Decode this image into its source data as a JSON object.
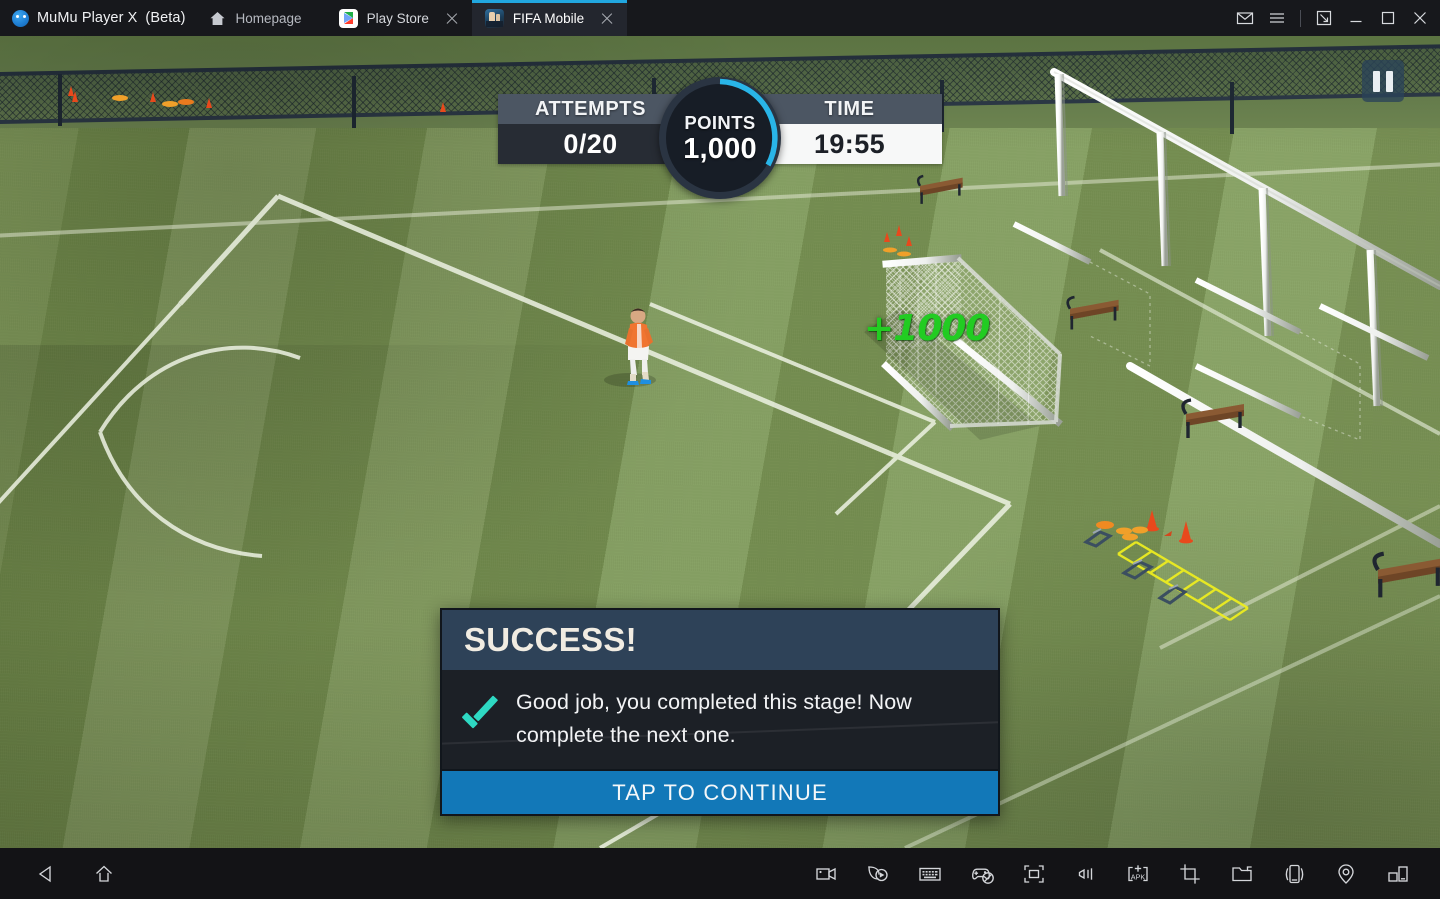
{
  "titlebar": {
    "app_name": "MuMu Player X",
    "app_suffix": "(Beta)",
    "homepage_label": "Homepage",
    "tabs": [
      {
        "label": "Play Store",
        "icon": "play-store-icon",
        "active": false
      },
      {
        "label": "FIFA Mobile",
        "icon": "fifa-mobile-icon",
        "active": true
      }
    ],
    "controls": [
      "mail-icon",
      "menu-icon",
      "resize-icon",
      "minimize-icon",
      "maximize-icon",
      "close-icon"
    ]
  },
  "hud": {
    "attempts_label": "ATTEMPTS",
    "attempts_value": "0/20",
    "points_label": "POINTS",
    "points_value": "1,000",
    "time_label": "TIME",
    "time_value": "19:55",
    "points_arc_percent": 40,
    "accent_color": "#29b5e8"
  },
  "field": {
    "score_popup": "+1000",
    "score_popup_color": "#22cc22",
    "pause_label": "pause"
  },
  "dialog": {
    "title": "SUCCESS!",
    "message": "Good job, you completed this stage! Now complete the next one.",
    "cta_label": "TAP TO CONTINUE",
    "title_bg": "#2e4258",
    "cta_bg": "#1278b8",
    "check_color": "#2ed9c3"
  },
  "bottombar": {
    "nav": [
      "back-icon",
      "home-icon"
    ],
    "tools": [
      "record-video-icon",
      "macro-script-icon",
      "keyboard-mapping-icon",
      "gamepad-disabled-icon",
      "fullscreen-icon",
      "volume-icon",
      "install-apk-icon",
      "screenshot-crop-icon",
      "shared-folder-icon",
      "shake-device-icon",
      "location-icon",
      "multi-instance-icon"
    ]
  }
}
